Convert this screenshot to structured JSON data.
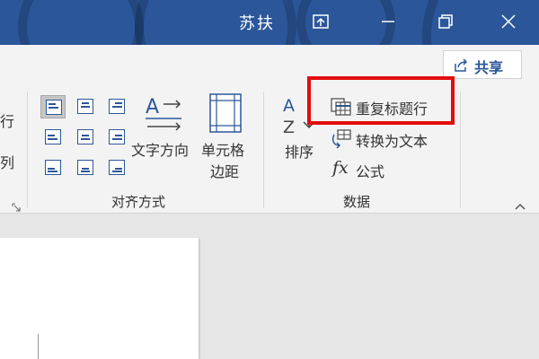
{
  "window": {
    "title": "苏扶"
  },
  "share": {
    "label": "共享"
  },
  "ribbon": {
    "left_cut": {
      "row1": "行",
      "row2": "列"
    },
    "alignment": {
      "text_direction": "文字方向",
      "cell_margins_line1": "单元格",
      "cell_margins_line2": "边距",
      "group_label": "对齐方式"
    },
    "data": {
      "sort": "排序",
      "repeat_header_rows": "重复标题行",
      "convert_to_text": "转换为文本",
      "formula": "公式",
      "formula_fx": "fx",
      "group_label": "数据"
    }
  },
  "colors": {
    "accent": "#2b579a",
    "highlight": "#e20d0d"
  }
}
